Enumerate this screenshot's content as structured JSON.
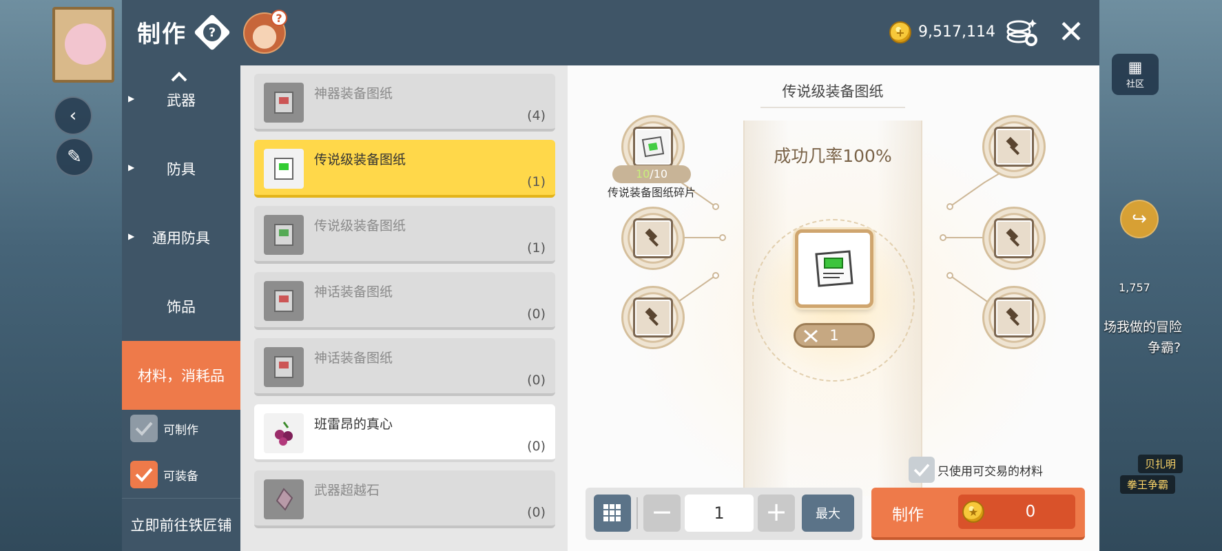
{
  "header": {
    "title": "制作",
    "help_icon": "question-diamond-icon",
    "meso": "9,517,114",
    "close_icon": "close-icon"
  },
  "sidebar": {
    "categories": [
      {
        "label": "武器",
        "active": false
      },
      {
        "label": "防具",
        "active": false
      },
      {
        "label": "通用防具",
        "active": false
      },
      {
        "label": "饰品",
        "active": false
      },
      {
        "label": "材料，消耗品",
        "active": true
      }
    ],
    "filters": [
      {
        "label": "可制作",
        "checked": false
      },
      {
        "label": "可装备",
        "checked": true
      }
    ],
    "go_smith": "立即前往铁匠铺"
  },
  "recipes": [
    {
      "name": "神器装备图纸",
      "count": "(4)",
      "state": "disabled",
      "icon": "blueprint-red-icon"
    },
    {
      "name": "传说级装备图纸",
      "count": "(1)",
      "state": "selected",
      "icon": "blueprint-green-icon"
    },
    {
      "name": "传说级装备图纸",
      "count": "(1)",
      "state": "disabled",
      "icon": "blueprint-green-icon"
    },
    {
      "name": "神话装备图纸",
      "count": "(0)",
      "state": "disabled",
      "icon": "blueprint-red-icon"
    },
    {
      "name": "神话装备图纸",
      "count": "(0)",
      "state": "disabled",
      "icon": "blueprint-red-icon"
    },
    {
      "name": "班雷昂的真心",
      "count": "(0)",
      "state": "available",
      "icon": "heart-berry-icon"
    },
    {
      "name": "武器超越石",
      "count": "(0)",
      "state": "disabled",
      "icon": "crystal-stone-icon"
    }
  ],
  "detail": {
    "title": "传说级装备图纸",
    "success_rate": "成功几率100%",
    "material": {
      "name": "传说装备图纸碎片",
      "have": "10",
      "need": "/10"
    },
    "make_count": "1",
    "trade_only_label": "只使用可交易的材料",
    "quantity": "1",
    "max_label": "最大",
    "craft_label": "制作",
    "craft_cost": "0"
  },
  "background": {
    "community_label": "社区",
    "potion_count": "1,757",
    "chat_text": "场我做的冒险",
    "chat_text2": "争霸?",
    "npc_name": "贝扎明",
    "npc_title": "拳王争霸"
  },
  "colors": {
    "accent": "#ee7a4a",
    "header": "#3f5567",
    "selected_row": "#ffd84a"
  }
}
